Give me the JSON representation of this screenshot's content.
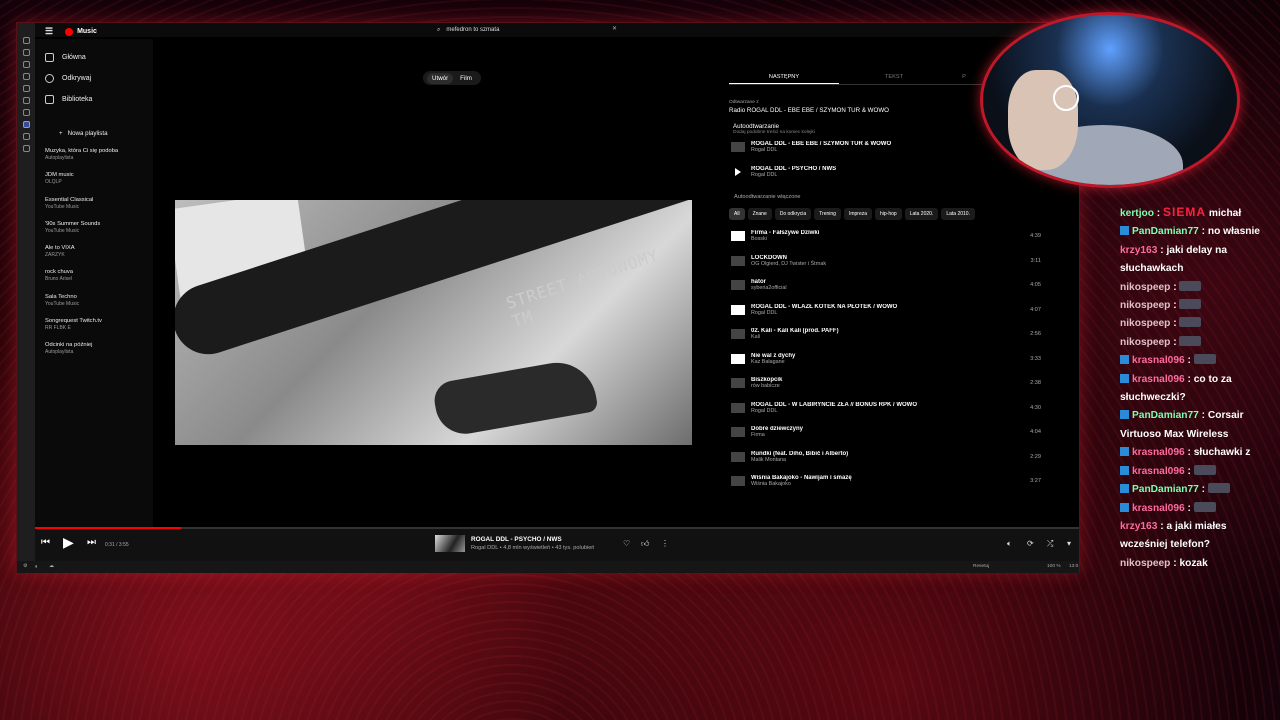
{
  "app": {
    "name": "Music",
    "search_value": "mefedron to szmata"
  },
  "sidebar": {
    "nav": [
      {
        "label": "Główna"
      },
      {
        "label": "Odkrywaj"
      },
      {
        "label": "Biblioteka"
      }
    ],
    "new_playlist": "Nowa playlista",
    "playlists": [
      {
        "title": "Muzyka, która Ci się podoba",
        "sub": "Autoplaylista"
      },
      {
        "title": "JDM music",
        "sub": "OLQLP"
      },
      {
        "title": "Essential Classical",
        "sub": "YouTube Music"
      },
      {
        "title": "'90s Summer Sounds",
        "sub": "YouTube Music"
      },
      {
        "title": "Ale to VIXA",
        "sub": "ZARZYK"
      },
      {
        "title": "rock chuva",
        "sub": "Bruno Arisel"
      },
      {
        "title": "Sala Techno",
        "sub": "YouTube Music"
      },
      {
        "title": "Songrequest Twitch.tv",
        "sub": "RR FLBK E"
      },
      {
        "title": "Odcinki na później",
        "sub": "Autoplaylista"
      }
    ]
  },
  "main": {
    "toggle": [
      "Utwór",
      "Film"
    ],
    "video_brand": "STREET AUTONOMY TM"
  },
  "queue": {
    "tabs": [
      "NASTĘPNY",
      "TEKST",
      "P"
    ],
    "from_label": "Odtwarzane z",
    "from_title": "Radio ROGAL DDL - EBE EBE / SZYMON TUR & WOWO",
    "autoplay_title": "Autoodtwarzanie",
    "autoplay_sub": "Dodaj podobne treści na koniec kolejki",
    "current": [
      {
        "title": "ROGAL DDL - EBE EBE / SZYMON TUR & WOWO",
        "artist": "Rogal DDL",
        "thumb": "dark"
      },
      {
        "title": "ROGAL DDL - PSYCHO / NWS",
        "artist": "Rogal DDL",
        "thumb": "play"
      }
    ],
    "autoplay_on": "Autoodtwarzanie włączone",
    "chips": [
      "All",
      "Znane",
      "Do odkrycia",
      "Trening",
      "Impreza",
      "hip-hop",
      "Lata 2020.",
      "Lata 2010."
    ],
    "tracks": [
      {
        "title": "Firma - Fałszywe Dziwki",
        "artist": "Bosski",
        "dur": "4:39",
        "thumb": "white"
      },
      {
        "title": "LOCKDOWN",
        "artist": "OG Olgierd, DJ Twister i Śtrnak",
        "dur": "3:11",
        "thumb": "dark"
      },
      {
        "title": "hator",
        "artist": "syberia2official",
        "dur": "4:05",
        "thumb": "dark"
      },
      {
        "title": "ROGAL DDL - WLAZŁ KOTEK NA PŁOTEK / WOWO",
        "artist": "Rogal DDL",
        "dur": "4:07",
        "thumb": "white"
      },
      {
        "title": "02. Kali - Kali Kali (prod. PAFF)",
        "artist": "Kali",
        "dur": "2:56",
        "thumb": "dark"
      },
      {
        "title": "Nie wal z dychy",
        "artist": "Kaz Bałagane",
        "dur": "3:33",
        "thumb": "white"
      },
      {
        "title": "Biszkopcik",
        "artist": "rów babicze",
        "dur": "2:38",
        "thumb": "dark"
      },
      {
        "title": "ROGAL DDL - W LABIRYNCIE ZŁA // BONUS RPK / WOWO",
        "artist": "Rogal DDL",
        "dur": "4:30",
        "thumb": "dark"
      },
      {
        "title": "Dobre dziewczyny",
        "artist": "Firma",
        "dur": "4:04",
        "thumb": "dark"
      },
      {
        "title": "Rundki (feat. Diho, Bibič i Alberto)",
        "artist": "Malik Montana",
        "dur": "2:29",
        "thumb": "dark"
      },
      {
        "title": "Wiśnia Bakajoko - Nawijam i smażę",
        "artist": "Wiśnia Bakajoko",
        "dur": "3:27",
        "thumb": "dark"
      }
    ]
  },
  "player": {
    "time": "0:31 / 3:55",
    "progress": 0.14,
    "title": "ROGAL DDL - PSYCHO / NWS",
    "sub": "Rogal DDL • 4,8 mln wyświetleń • 43 tys. polubień"
  },
  "statusbar": {
    "reset": "Resetuj",
    "zoom": "100 %",
    "clock": "13:0"
  },
  "chat": [
    {
      "user": "kertjoo",
      "color": "green",
      "text": "michał",
      "siema": "SIEMA"
    },
    {
      "user": "PanDamian77",
      "color": "green",
      "text": "no własnie",
      "badge": true
    },
    {
      "user": "krzy163",
      "color": "purple",
      "text": "jaki delay na słuchawkach"
    },
    {
      "user": "nikospeep",
      "color": "dim",
      "emote": true
    },
    {
      "user": "nikospeep",
      "color": "dim",
      "emote": true
    },
    {
      "user": "nikospeep",
      "color": "dim",
      "emote": true
    },
    {
      "user": "nikospeep",
      "color": "dim",
      "emote": true
    },
    {
      "user": "krasnal096",
      "color": "purple",
      "emote": true,
      "badge": true
    },
    {
      "user": "krasnal096",
      "color": "purple",
      "text": "co to za słuchweczki?",
      "badge": true
    },
    {
      "user": "PanDamian77",
      "color": "green",
      "text": "Corsair Virtuoso Max Wireless",
      "badge": true
    },
    {
      "user": "krasnal096",
      "color": "purple",
      "text": "słuchawki z",
      "badge": true
    },
    {
      "user": "krasnal096",
      "color": "purple",
      "emote": true,
      "badge": true
    },
    {
      "user": "PanDamian77",
      "color": "green",
      "emote": true,
      "badge": true
    },
    {
      "user": "krasnal096",
      "color": "purple",
      "emote": true,
      "badge": true
    },
    {
      "user": "krzy163",
      "color": "purple",
      "text": "a jaki miałes wcześniej telefon?"
    },
    {
      "user": "nikospeep",
      "color": "dim",
      "text": "kozak"
    }
  ]
}
